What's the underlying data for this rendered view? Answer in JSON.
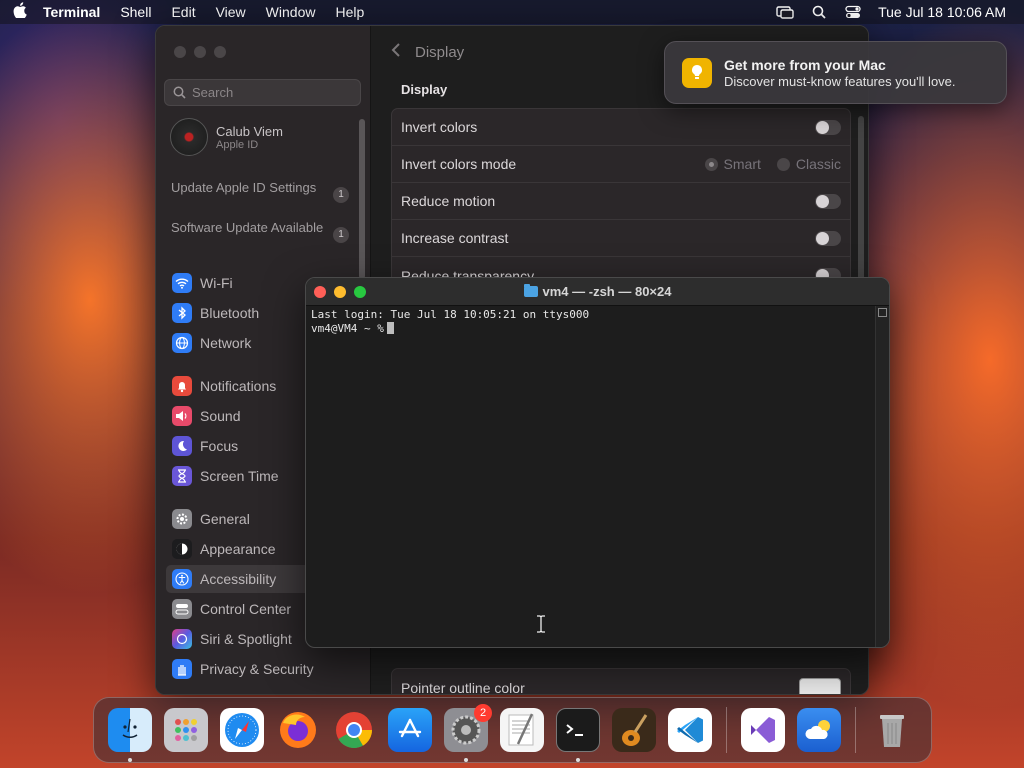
{
  "menubar": {
    "app_name": "Terminal",
    "items": [
      "Shell",
      "Edit",
      "View",
      "Window",
      "Help"
    ],
    "clock": "Tue Jul 18  10:06 AM"
  },
  "settings": {
    "search_placeholder": "Search",
    "user": {
      "name": "Calub Viem",
      "sub": "Apple ID"
    },
    "notices": [
      {
        "label": "Update Apple ID Settings",
        "count": "1"
      },
      {
        "label": "Software Update Available",
        "count": "1"
      }
    ],
    "nav": [
      {
        "label": "Wi-Fi",
        "icon": "wifi-icon",
        "color": "#2f7cf6"
      },
      {
        "label": "Bluetooth",
        "icon": "bluetooth-icon",
        "color": "#2f7cf6"
      },
      {
        "label": "Network",
        "icon": "globe-icon",
        "color": "#2f7cf6"
      },
      {
        "label": "Notifications",
        "icon": "bell-icon",
        "color": "#e84a3c"
      },
      {
        "label": "Sound",
        "icon": "speaker-icon",
        "color": "#e84a6a"
      },
      {
        "label": "Focus",
        "icon": "moon-icon",
        "color": "#5e55d6"
      },
      {
        "label": "Screen Time",
        "icon": "hourglass-icon",
        "color": "#6a57d8"
      },
      {
        "label": "General",
        "icon": "gear-icon",
        "color": "#8a8a8e"
      },
      {
        "label": "Appearance",
        "icon": "appearance-icon",
        "color": "#1c1c1e"
      },
      {
        "label": "Accessibility",
        "icon": "accessibility-icon",
        "color": "#2f7cf6"
      },
      {
        "label": "Control Center",
        "icon": "control-center-icon",
        "color": "#8a8a8e"
      },
      {
        "label": "Siri & Spotlight",
        "icon": "siri-icon",
        "color": "#b04ad6"
      },
      {
        "label": "Privacy & Security",
        "icon": "hand-icon",
        "color": "#2f7cf6"
      }
    ],
    "selected_nav": "Accessibility",
    "header_title": "Display",
    "section_title": "Display",
    "rows": {
      "invert_colors": "Invert colors",
      "invert_mode": "Invert colors mode",
      "mode_smart": "Smart",
      "mode_classic": "Classic",
      "reduce_motion": "Reduce motion",
      "increase_contrast": "Increase contrast",
      "reduce_transparency": "Reduce transparency",
      "pointer_outline": "Pointer outline color"
    }
  },
  "notification": {
    "title": "Get more from your Mac",
    "body": "Discover must-know features you'll love."
  },
  "terminal": {
    "title": "vm4 — -zsh — 80×24",
    "line1": "Last login: Tue Jul 18 10:05:21 on ttys000",
    "prompt": "vm4@VM4 ~ %"
  },
  "dock": {
    "apps": [
      "Finder",
      "Launchpad",
      "Safari",
      "Firefox",
      "Chrome",
      "App Store",
      "System Settings",
      "TextEdit",
      "Terminal",
      "GarageBand",
      "Visual Studio Code"
    ],
    "settings_badge": "2",
    "extra": [
      "Visual Studio",
      "Weather"
    ],
    "trash": "Trash"
  }
}
